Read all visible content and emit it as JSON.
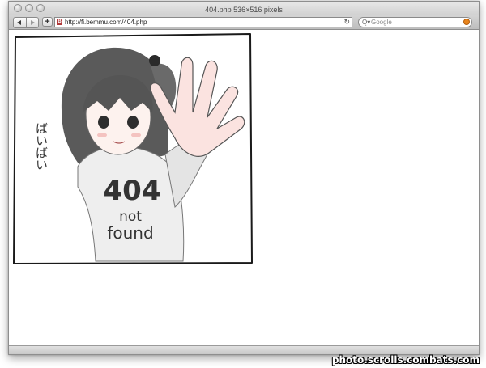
{
  "window": {
    "title": "404.php 536×516 pixels"
  },
  "toolbar": {
    "url": "http://fi.bemmu.com/404.php",
    "search_placeholder": "Google",
    "add_label": "+",
    "favicon_letter": "B",
    "reload_symbol": "↻",
    "search_symbol": "Q▾"
  },
  "illustration": {
    "shirt_line1": "404",
    "shirt_line2": "not",
    "shirt_line3": "found",
    "side_text": "ばいばい"
  },
  "watermark": "photo.scrolls.combats.com"
}
